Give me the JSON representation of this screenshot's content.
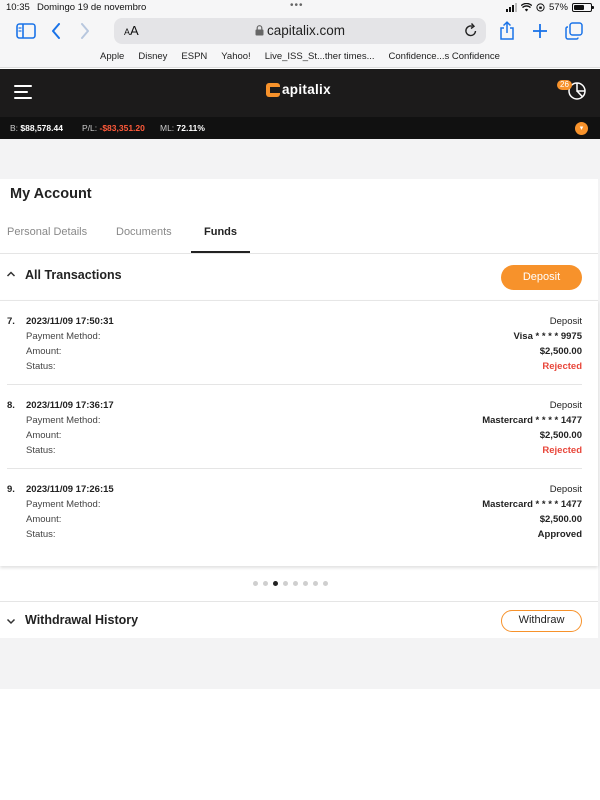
{
  "status_bar": {
    "time": "10:35",
    "date": "Domingo 19 de novembro",
    "dots": "•••",
    "battery": "57%"
  },
  "browser": {
    "text_size_label": "AA",
    "url": "capitalix.com",
    "bookmarks": [
      "Apple",
      "Disney",
      "ESPN",
      "Yahoo!",
      "Live_ISS_St...ther times...",
      "Confidence...s Confidence"
    ]
  },
  "app": {
    "brand": "apitalix",
    "notification_count": "26",
    "balance_label": "B:",
    "balance_value": "$88,578.44",
    "pl_label": "P/L:",
    "pl_value": "-$83,351.20",
    "ml_label": "ML:",
    "ml_value": "72.11%"
  },
  "page": {
    "title": "My Account",
    "tabs": [
      "Personal Details",
      "Documents",
      "Funds"
    ],
    "active_tab": "Funds"
  },
  "transactions_section": {
    "title": "All Transactions",
    "deposit_label": "Deposit",
    "labels": {
      "payment_method": "Payment Method:",
      "amount": "Amount:",
      "status": "Status:"
    },
    "items": [
      {
        "num": "7.",
        "datetime": "2023/11/09 17:50:31",
        "type": "Deposit",
        "method": "Visa  * * * *  9975",
        "amount": "$2,500.00",
        "status": "Rejected"
      },
      {
        "num": "8.",
        "datetime": "2023/11/09 17:36:17",
        "type": "Deposit",
        "method": "Mastercard  * * * *  1477",
        "amount": "$2,500.00",
        "status": "Rejected"
      },
      {
        "num": "9.",
        "datetime": "2023/11/09 17:26:15",
        "type": "Deposit",
        "method": "Mastercard  * * * *  1477",
        "amount": "$2,500.00",
        "status": "Approved"
      }
    ],
    "pager": {
      "pages": 8,
      "current": 3
    }
  },
  "withdrawal_section": {
    "title": "Withdrawal History",
    "withdraw_label": "Withdraw"
  },
  "colors": {
    "accent": "#f7922b",
    "header_bg": "#1c1b1b",
    "rejected": "#e8463a",
    "negative": "#ff5a3a"
  }
}
